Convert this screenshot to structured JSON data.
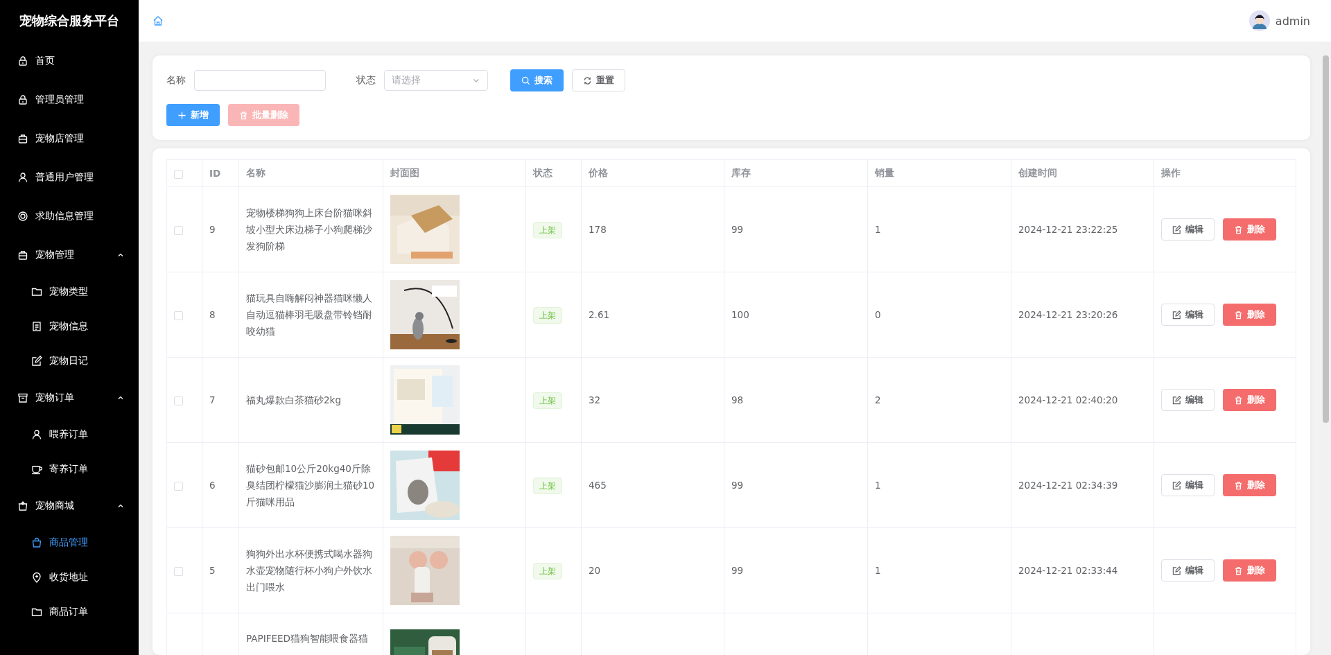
{
  "sidebar": {
    "title": "宠物综合服务平台",
    "items": [
      {
        "label": "首页",
        "selected": false
      },
      {
        "label": "管理员管理",
        "selected": false
      },
      {
        "label": "宠物店管理",
        "selected": false
      },
      {
        "label": "普通用户管理",
        "selected": false
      },
      {
        "label": "求助信息管理",
        "selected": false
      },
      {
        "label": "宠物管理",
        "expanded": true,
        "children": [
          {
            "label": "宠物类型",
            "selected": false
          },
          {
            "label": "宠物信息",
            "selected": false
          },
          {
            "label": "宠物日记",
            "selected": false
          }
        ]
      },
      {
        "label": "宠物订单",
        "expanded": true,
        "children": [
          {
            "label": "喂养订单",
            "selected": false
          },
          {
            "label": "寄养订单",
            "selected": false
          }
        ]
      },
      {
        "label": "宠物商城",
        "expanded": true,
        "children": [
          {
            "label": "商品管理",
            "selected": true
          },
          {
            "label": "收货地址",
            "selected": false
          },
          {
            "label": "商品订单",
            "selected": false
          }
        ]
      }
    ]
  },
  "header": {
    "user": "admin"
  },
  "filter": {
    "name_label": "名称",
    "status_label": "状态",
    "status_placeholder": "请选择",
    "search": "搜索",
    "reset": "重置",
    "add": "新增",
    "batch_delete": "批量删除",
    "batch_delete_disabled": true
  },
  "table": {
    "select_all_checked": false,
    "columns": [
      "ID",
      "名称",
      "封面图",
      "状态",
      "价格",
      "库存",
      "销量",
      "创建时间",
      "操作"
    ],
    "rows": [
      {
        "checked": false,
        "id": "9",
        "name": "宠物楼梯狗狗上床台阶猫咪斜坡小型犬床边梯子小狗爬梯沙发狗阶梯",
        "status": "上架",
        "price": "178",
        "stock": "99",
        "sales": "1",
        "created": "2024-12-21 23:22:25",
        "edit": "编辑",
        "delete": "删除"
      },
      {
        "checked": false,
        "id": "8",
        "name": "猫玩具自嗨解闷神器猫咪懒人自动逗猫棒羽毛吸盘带铃铛耐咬幼猫",
        "status": "上架",
        "price": "2.61",
        "stock": "100",
        "sales": "0",
        "created": "2024-12-21 23:20:26",
        "edit": "编辑",
        "delete": "删除"
      },
      {
        "checked": false,
        "id": "7",
        "name": "福丸爆款白茶猫砂2kg",
        "status": "上架",
        "price": "32",
        "stock": "98",
        "sales": "2",
        "created": "2024-12-21 02:40:20",
        "edit": "编辑",
        "delete": "删除"
      },
      {
        "checked": false,
        "id": "6",
        "name": "猫砂包邮10公斤20kg40斤除臭结团柠檬猫沙膨润土猫砂10斤猫咪用品",
        "status": "上架",
        "price": "465",
        "stock": "99",
        "sales": "1",
        "created": "2024-12-21 02:34:39",
        "edit": "编辑",
        "delete": "删除"
      },
      {
        "checked": false,
        "id": "5",
        "name": "狗狗外出水杯便携式喝水器狗水壶宠物随行杯小狗户外饮水出门喂水",
        "status": "上架",
        "price": "20",
        "stock": "99",
        "sales": "1",
        "created": "2024-12-21 02:33:44",
        "edit": "编辑",
        "delete": "删除"
      },
      {
        "name": "PAPIFEED猫狗智能喂食器猫"
      }
    ]
  }
}
